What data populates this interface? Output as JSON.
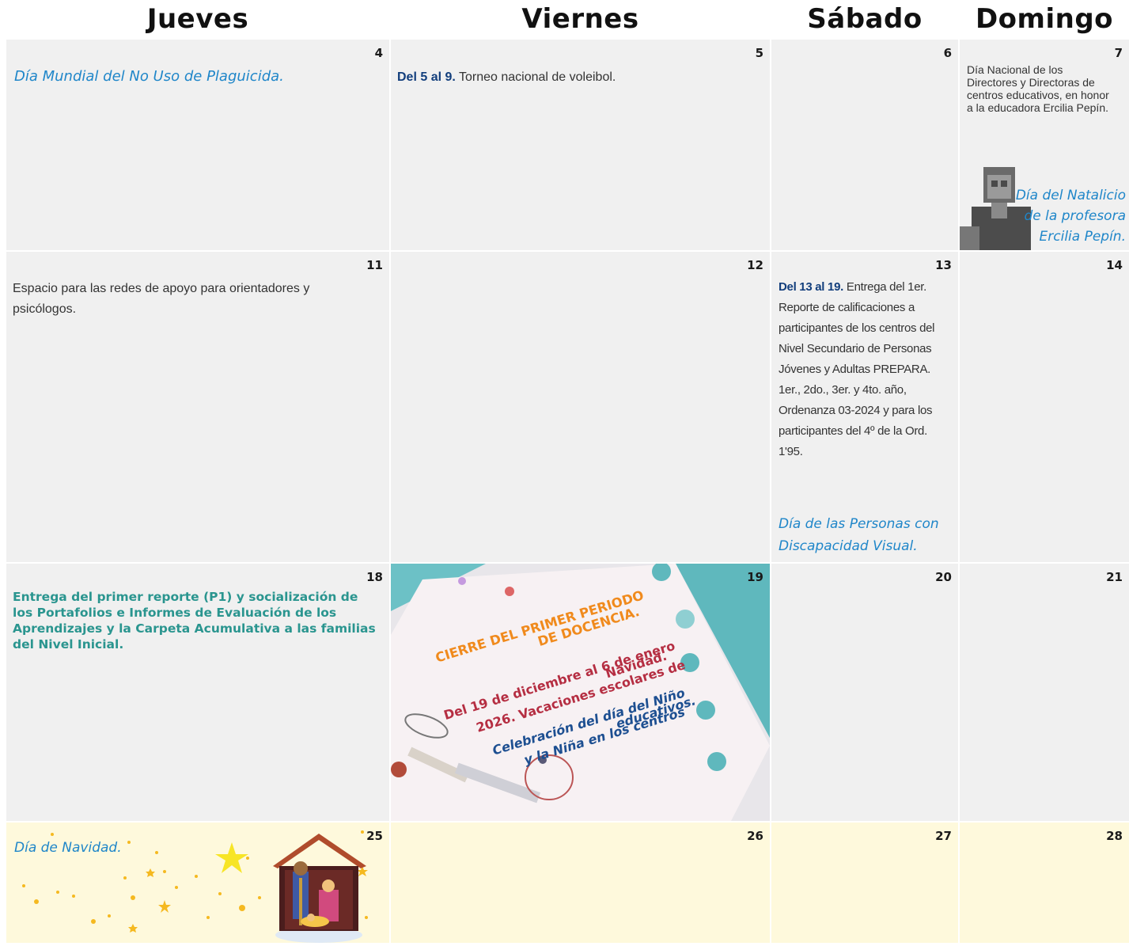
{
  "headers": [
    "Jueves",
    "Viernes",
    "Sábado",
    "Domingo"
  ],
  "days": {
    "d4": {
      "num": "4",
      "text": "Día Mundial del No Uso de Plaguicida."
    },
    "d5": {
      "num": "5",
      "bold": "Del 5 al 9.",
      "text": " Torneo nacional de voleibol."
    },
    "d6": {
      "num": "6"
    },
    "d7": {
      "num": "7",
      "text": "Día Nacional de los Directores y Directoras de centros educativos, en honor a la educadora Ercilia Pepín.",
      "script": "Día del Natalicio de la profesora Ercilia Pepín."
    },
    "d11": {
      "num": "11",
      "text": "Espacio para las redes de apoyo para orientadores y psicólogos."
    },
    "d12": {
      "num": "12"
    },
    "d13": {
      "num": "13",
      "bold": "Del 13 al 19.",
      "text": " Entrega del 1er. Reporte de calificaciones a participantes de los centros del Nivel Secundario de Personas Jóvenes y Adultas PREPARA. 1er., 2do., 3er. y 4to. año, Ordenanza 03-2024 y para los participantes del 4º de la Ord. 1'95.",
      "script": "Día de las Personas con Discapacidad Visual."
    },
    "d14": {
      "num": "14"
    },
    "d18": {
      "num": "18",
      "text": "Entrega del primer reporte (P1) y socialización de los Portafolios e Informes de Evaluación de los Aprendizajes y la Carpeta Acumulativa a las familias del Nivel Inicial."
    },
    "d19": {
      "num": "19",
      "line1": "CIERRE DEL PRIMER PERIODO",
      "line2": "DE DOCENCIA.",
      "line3": "Del 19 de diciembre al 6 de enero",
      "line4": "2026. Vacaciones escolares de",
      "line5": "Navidad.",
      "line6": "Celebración del día del Niño",
      "line7": "y la Niña en los centros",
      "line8": "educativos."
    },
    "d20": {
      "num": "20"
    },
    "d21": {
      "num": "21"
    },
    "d25": {
      "num": "25",
      "text": "Día de Navidad."
    },
    "d26": {
      "num": "26"
    },
    "d27": {
      "num": "27"
    },
    "d28": {
      "num": "28"
    }
  },
  "colors": {
    "cell_gray": "#f0f0f0",
    "cell_yellow": "#fef9dc",
    "script_blue": "#1f86c9",
    "navy": "#123e7c",
    "teal": "#2a958f",
    "orange": "#f08a1c",
    "crimson": "#b52e42"
  }
}
